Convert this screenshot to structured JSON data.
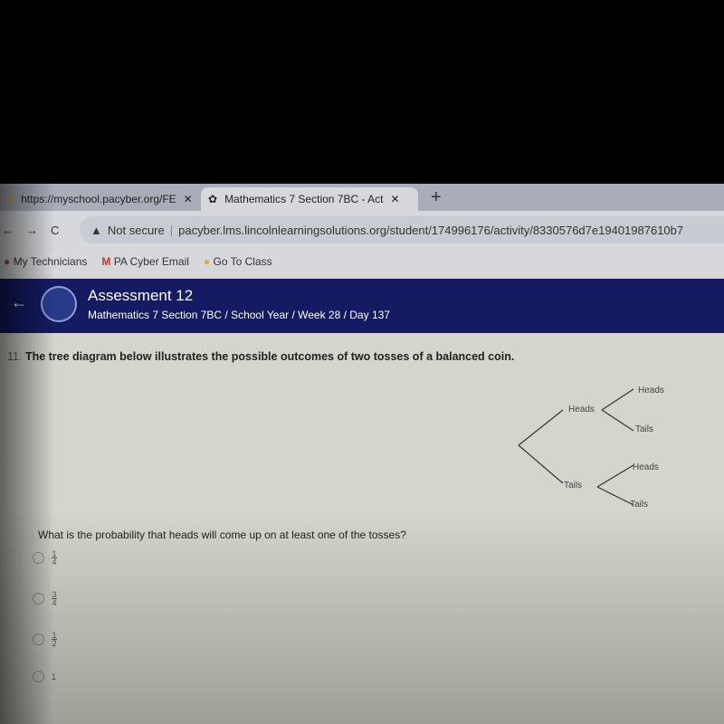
{
  "browser": {
    "tabs": [
      {
        "label": "https://myschool.pacyber.org/FE"
      },
      {
        "label": "Mathematics 7 Section 7BC - Act"
      }
    ],
    "new_tab": "+",
    "security": "Not secure",
    "url": "pacyber.lms.lincolnlearningsolutions.org/student/174996176/activity/8330576d7e19401987610b7",
    "bookmarks": [
      {
        "label": "My Technicians"
      },
      {
        "label": "PA Cyber Email"
      },
      {
        "label": "Go To Class"
      }
    ]
  },
  "header": {
    "title": "Assessment 12",
    "breadcrumb": "Mathematics 7 Section 7BC / School Year / Week 28 / Day 137"
  },
  "question": {
    "number": "11.",
    "text": "The tree diagram below illustrates the possible outcomes of two tosses of a balanced coin.",
    "prompt": "What is the probability that heads will come up on at least one of the tosses?",
    "tree": {
      "first": [
        "Heads",
        "Tails"
      ],
      "second": [
        "Heads",
        "Tails",
        "Heads",
        "Tails"
      ]
    },
    "options": [
      {
        "num": "1",
        "den": "4"
      },
      {
        "num": "3",
        "den": "4"
      },
      {
        "num": "1",
        "den": "2"
      },
      {
        "whole": "1"
      }
    ]
  }
}
